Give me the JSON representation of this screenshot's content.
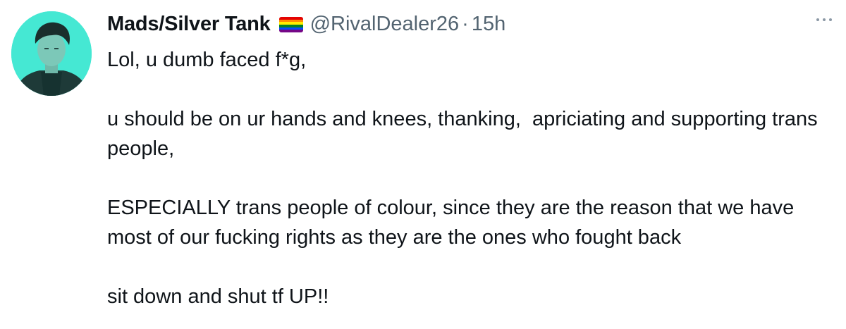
{
  "author": {
    "display_name": "Mads/Silver Tank",
    "flag_icon": "rainbow-pride-flag-icon",
    "handle": "@RivalDealer26",
    "separator": "·",
    "time": "15h"
  },
  "more_icon": "more-horizontal-icon",
  "tweet": {
    "paragraphs": [
      "Lol, u dumb faced f*g,",
      "",
      "u should be on ur hands and knees, thanking,  apriciating and supporting trans people,",
      "",
      "ESPECIALLY trans people of colour, since they are the reason that we have most of our fucking rights as they are the ones who fought back",
      "",
      "sit down and shut tf UP!!"
    ]
  },
  "colors": {
    "text": "#0f1419",
    "secondary": "#536471",
    "avatar_bg": "#45e8d3",
    "flag": [
      "#e40303",
      "#ff8c00",
      "#ffed00",
      "#008026",
      "#004dff",
      "#750787"
    ]
  }
}
